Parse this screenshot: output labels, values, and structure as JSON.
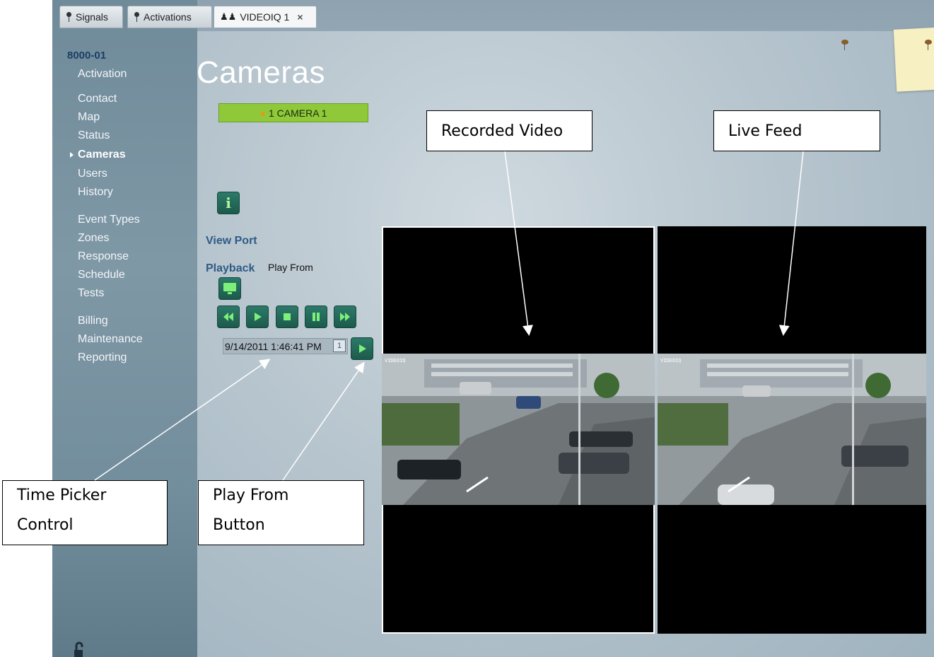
{
  "tabs": [
    {
      "label": "Signals",
      "icon": "pin-icon"
    },
    {
      "label": "Activations",
      "icon": "pin-icon"
    },
    {
      "label": "VIDEOIQ 1",
      "icon": "users-icon",
      "close": "×"
    }
  ],
  "sidebar": {
    "account": "8000-01",
    "items": [
      {
        "label": "Activation"
      },
      {
        "label": "Contact"
      },
      {
        "label": "Map"
      },
      {
        "label": "Status"
      },
      {
        "label": "Cameras",
        "selected": true
      },
      {
        "label": "Users"
      },
      {
        "label": "History"
      },
      {
        "label": "Event Types"
      },
      {
        "label": "Zones"
      },
      {
        "label": "Response"
      },
      {
        "label": "Schedule"
      },
      {
        "label": "Tests"
      },
      {
        "label": "Billing"
      },
      {
        "label": "Maintenance"
      },
      {
        "label": "Reporting"
      }
    ]
  },
  "main": {
    "title": "Cameras",
    "camera_item": "1 CAMERA 1",
    "view_port_label": "View Port",
    "playback_label": "Playback",
    "play_from_label": "Play From",
    "time_value": "9/14/2011 1:46:41 PM",
    "playback_controls": [
      "rewind",
      "play",
      "stop",
      "pause",
      "fast-forward"
    ],
    "video_osd": "VIDEOIQ"
  },
  "annotations": {
    "recorded_video": "Recorded Video",
    "live_feed": "Live Feed",
    "time_picker_line1": "Time Picker",
    "time_picker_line2": "Control",
    "play_from_line1": "Play From",
    "play_from_line2": "Button"
  },
  "colors": {
    "accent_green": "#8fc93a",
    "button_teal": "#1c5a4c",
    "link_blue": "#2f5b86"
  }
}
